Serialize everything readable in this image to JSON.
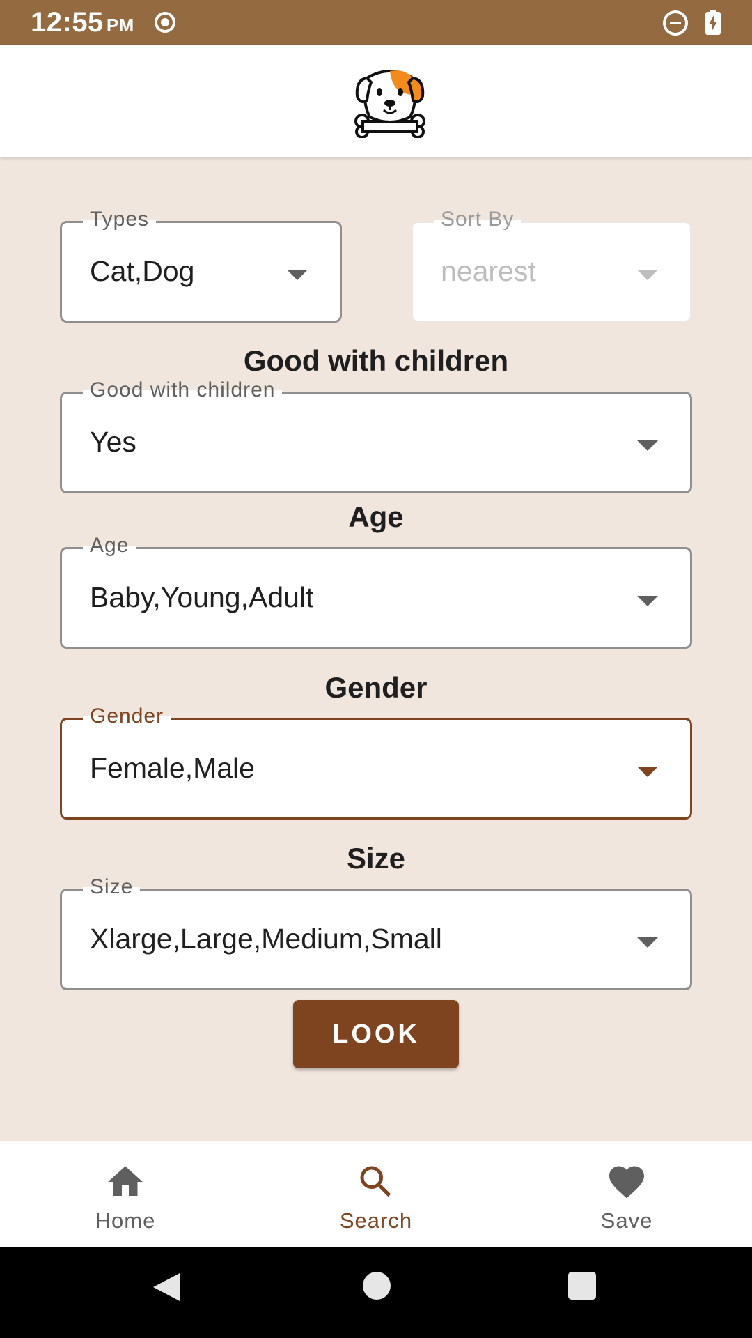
{
  "status_bar": {
    "time": "12:55",
    "ampm": "PM"
  },
  "colors": {
    "status_bar": "#946a40",
    "accent": "#7e4420",
    "background": "#f0e6de"
  },
  "filters": {
    "types": {
      "label": "Types",
      "value": "Cat,Dog"
    },
    "sort_by": {
      "label": "Sort By",
      "value": "nearest",
      "disabled": true
    },
    "good_with_children": {
      "heading": "Good with children",
      "label": "Good with children",
      "value": "Yes"
    },
    "age": {
      "heading": "Age",
      "label": "Age",
      "value": "Baby,Young,Adult"
    },
    "gender": {
      "heading": "Gender",
      "label": "Gender",
      "value": "Female,Male",
      "focused": true
    },
    "size": {
      "heading": "Size",
      "label": "Size",
      "value": "Xlarge,Large,Medium,Small"
    }
  },
  "look_button": {
    "label": "LOOK"
  },
  "bottom_nav": [
    {
      "label": "Home",
      "icon": "home-icon",
      "active": false
    },
    {
      "label": "Search",
      "icon": "search-icon",
      "active": true
    },
    {
      "label": "Save",
      "icon": "heart-icon",
      "active": false
    }
  ],
  "system_nav": {
    "icons": [
      "back-icon",
      "home-circle-icon",
      "recents-icon"
    ]
  }
}
